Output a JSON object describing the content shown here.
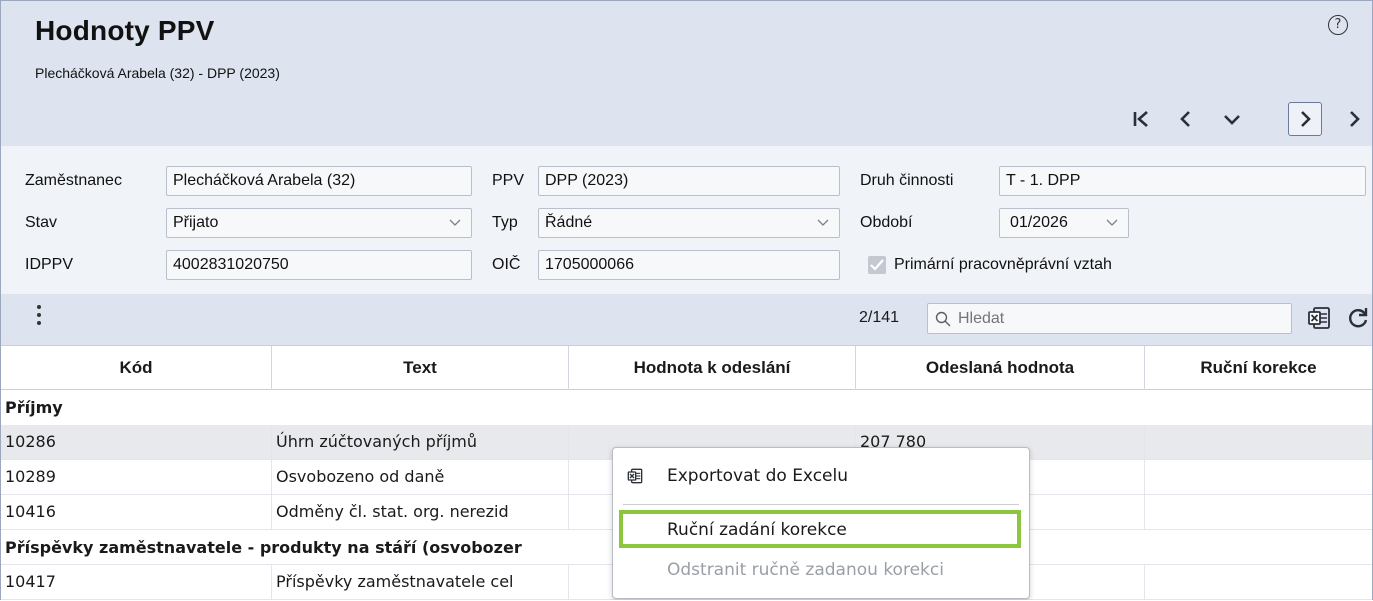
{
  "header": {
    "title": "Hodnoty PPV",
    "subtitle": "Plecháčková Arabela (32) - DPP (2023)",
    "help_glyph": "?"
  },
  "nav": {
    "icons": [
      "first-icon",
      "previous-icon",
      "dropdown-icon",
      "next-icon",
      "last-icon"
    ]
  },
  "form": {
    "zamestnanec_label": "Zaměstnanec",
    "zamestnanec_value": "Plecháčková Arabela (32)",
    "ppv_label": "PPV",
    "ppv_value": "DPP (2023)",
    "druh_label": "Druh činnosti",
    "druh_value": "T - 1. DPP",
    "stav_label": "Stav",
    "stav_value": "Přijato",
    "typ_label": "Typ",
    "typ_value": "Řádné",
    "obdobi_label": "Období",
    "obdobi_value": "01/2026",
    "idppv_label": "IDPPV",
    "idppv_value": "4002831020750",
    "oic_label": "OIČ",
    "oic_value": "1705000066",
    "primarni_label": "Primární pracovněprávní vztah",
    "primarni_checked": true
  },
  "toolbar": {
    "count": "2/141",
    "search_placeholder": "Hledat"
  },
  "table": {
    "columns": [
      "Kód",
      "Text",
      "Hodnota k odeslání",
      "Odeslaná hodnota",
      "Ruční korekce"
    ],
    "group1": "Příjmy",
    "rows1": [
      {
        "kod": "10286",
        "text": "Úhrn zúčtovaných příjmů",
        "hodnota": "",
        "odeslana": "207 780",
        "korekce": ""
      },
      {
        "kod": "10289",
        "text": "Osvobozeno od daně",
        "hodnota": "",
        "odeslana": "",
        "korekce": ""
      },
      {
        "kod": "10416",
        "text": "Odměny čl. stat. org. nerezid",
        "hodnota": "",
        "odeslana": "",
        "korekce": ""
      }
    ],
    "group2": "Příspěvky zaměstnavatele - produkty na stáří (osvobozer",
    "rows2": [
      {
        "kod": "10417",
        "text": "Příspěvky zaměstnavatele cel",
        "hodnota": "",
        "odeslana": "",
        "korekce": ""
      }
    ]
  },
  "context_menu": {
    "export": "Exportovat do Excelu",
    "manual": "Ruční zadání korekce",
    "remove": "Odstranit ručně zadanou korekci",
    "highlight_color": "#8cc63f"
  }
}
